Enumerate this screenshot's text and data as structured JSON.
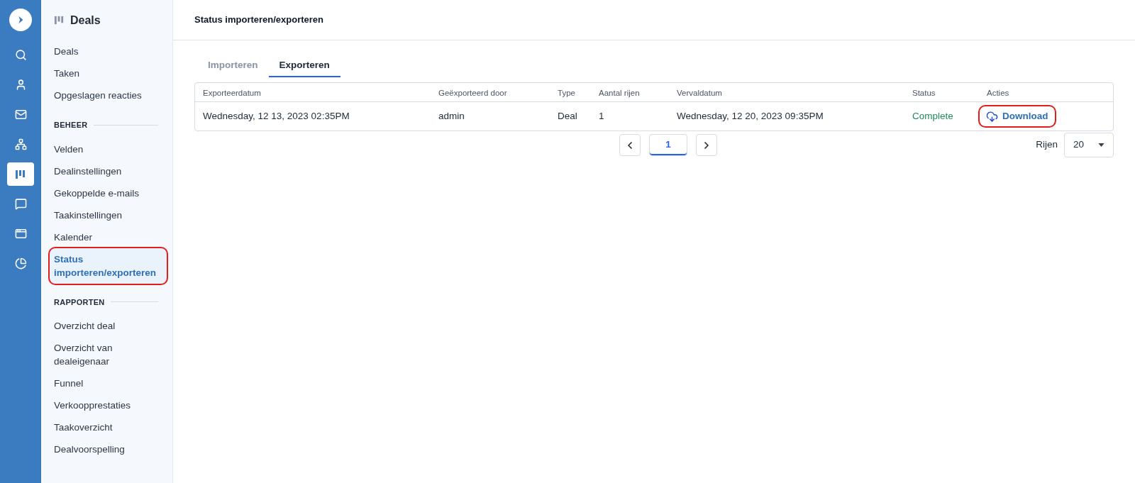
{
  "rail": {
    "items": [
      {
        "kind": "search",
        "selected": false
      },
      {
        "kind": "person",
        "selected": false
      },
      {
        "kind": "mail",
        "selected": false
      },
      {
        "kind": "sitemap",
        "selected": false
      },
      {
        "kind": "board",
        "selected": true
      },
      {
        "kind": "chat",
        "selected": false
      },
      {
        "kind": "window",
        "selected": false
      },
      {
        "kind": "pie",
        "selected": false
      }
    ]
  },
  "sidebar": {
    "title": "Deals",
    "sections": [
      {
        "items": [
          {
            "label": "Deals",
            "selected": false,
            "highlighted": false
          },
          {
            "label": "Taken",
            "selected": false,
            "highlighted": false
          },
          {
            "label": "Opgeslagen reacties",
            "selected": false,
            "highlighted": false
          }
        ]
      },
      {
        "heading": "BEHEER",
        "items": [
          {
            "label": "Velden",
            "selected": false,
            "highlighted": false
          },
          {
            "label": "Dealinstellingen",
            "selected": false,
            "highlighted": false
          },
          {
            "label": "Gekoppelde e-mails",
            "selected": false,
            "highlighted": false
          },
          {
            "label": "Taakinstellingen",
            "selected": false,
            "highlighted": false
          },
          {
            "label": "Kalender",
            "selected": false,
            "highlighted": false
          },
          {
            "label": "Status importeren/exporteren",
            "selected": true,
            "highlighted": true
          }
        ]
      },
      {
        "heading": "RAPPORTEN",
        "items": [
          {
            "label": "Overzicht deal",
            "selected": false,
            "highlighted": false
          },
          {
            "label": "Overzicht van dealeigenaar",
            "selected": false,
            "highlighted": false
          },
          {
            "label": "Funnel",
            "selected": false,
            "highlighted": false
          },
          {
            "label": "Verkoopprestaties",
            "selected": false,
            "highlighted": false
          },
          {
            "label": "Taakoverzicht",
            "selected": false,
            "highlighted": false
          },
          {
            "label": "Dealvoorspelling",
            "selected": false,
            "highlighted": false
          }
        ]
      }
    ]
  },
  "page": {
    "title": "Status importeren/exporteren"
  },
  "tabs": [
    {
      "label": "Importeren",
      "selected": false
    },
    {
      "label": "Exporteren",
      "selected": true
    }
  ],
  "table": {
    "columns": [
      "Exporteerdatum",
      "Geëxporteerd door",
      "Type",
      "Aantal rijen",
      "Vervaldatum",
      "Status",
      "Acties"
    ],
    "rows": [
      {
        "export_date": "Wednesday, 12 13, 2023 02:35PM",
        "exported_by": "admin",
        "type": "Deal",
        "rows": "1",
        "expiry_date": "Wednesday, 12 20, 2023 09:35PM",
        "status": "Complete",
        "color": "#1f8a5c",
        "action": "Download",
        "action_highlighted": true
      }
    ]
  },
  "pagination": {
    "pages": [
      {
        "label": "1",
        "selected": true
      }
    ],
    "rows_label": "Rijen",
    "rows_value": "20"
  }
}
